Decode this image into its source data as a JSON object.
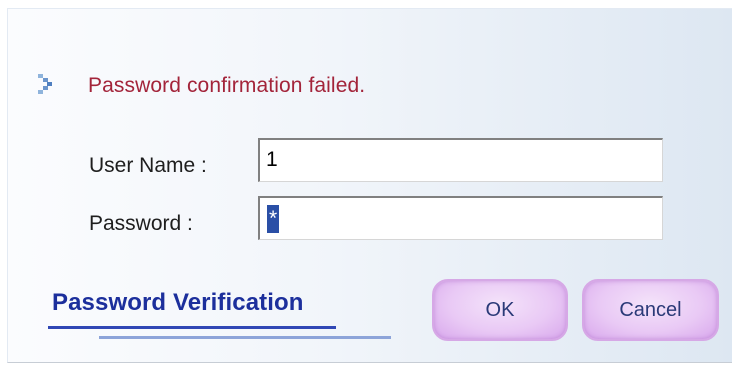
{
  "message": {
    "icon": "bullet-arrow-icon",
    "text": "Password confirmation failed.",
    "color": "#a3243a"
  },
  "form": {
    "username_label": "User Name :",
    "username_value": "1",
    "password_label": "Password :",
    "password_value": "*"
  },
  "brand": {
    "title": "Password Verification",
    "color": "#1c2f9c"
  },
  "buttons": {
    "ok_label": "OK",
    "cancel_label": "Cancel"
  }
}
